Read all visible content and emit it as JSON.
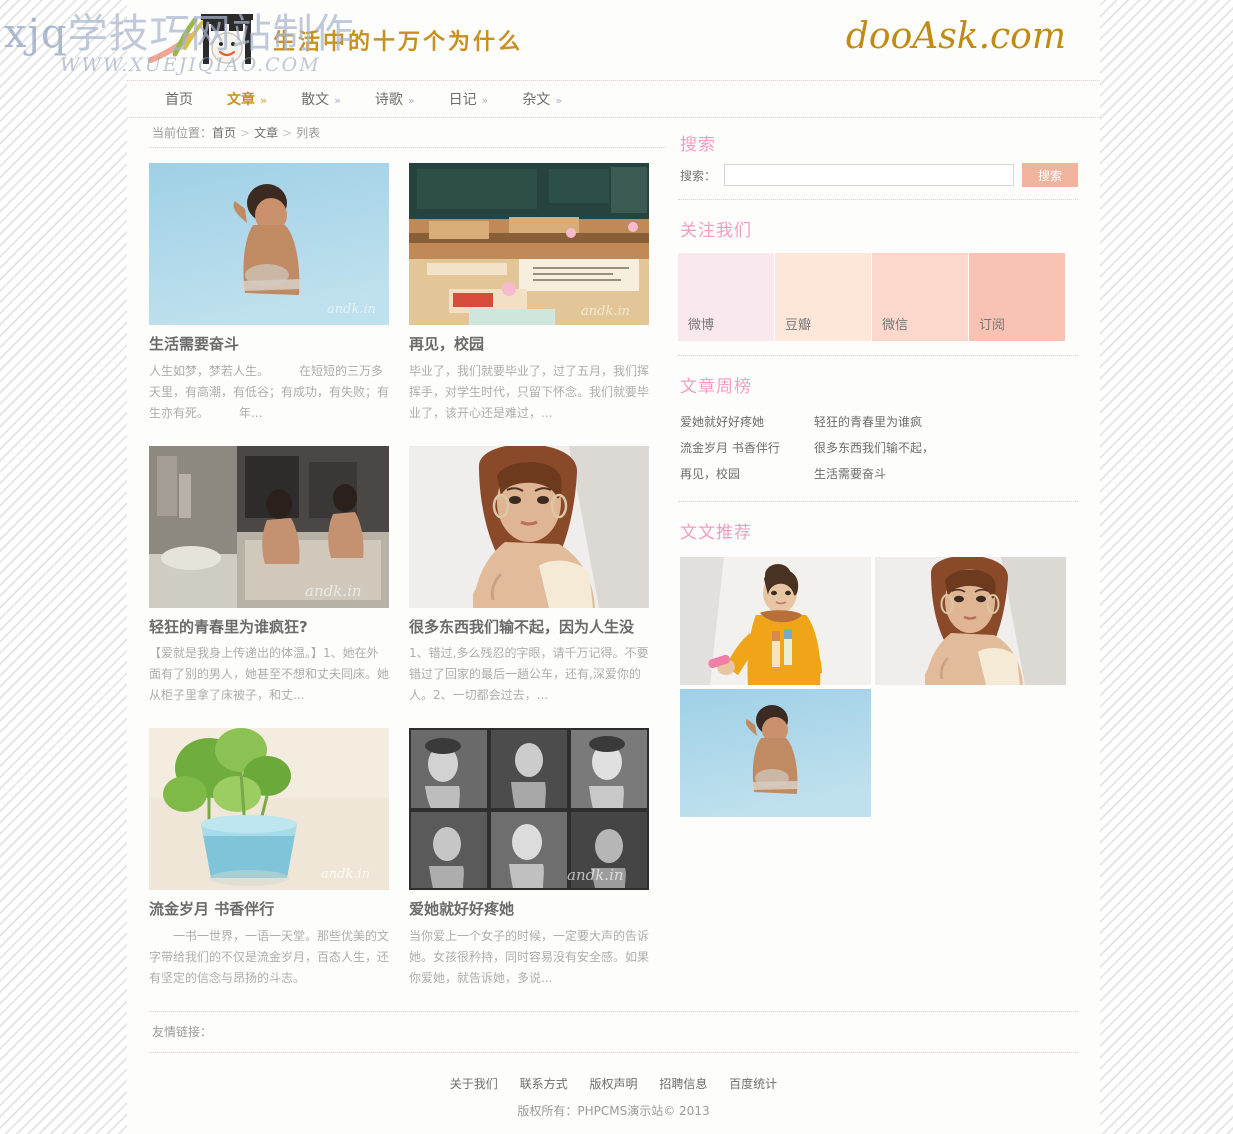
{
  "watermark": {
    "line1_latin": "xjq",
    "line1_cn": "学技巧网站制作",
    "line2": "WWW.XUEJIQIAO.COM"
  },
  "header": {
    "slogan": "生活中的十万个为什么",
    "brand": "dooAsk.com",
    "logo_icon": "gate-face-logo-icon"
  },
  "nav": {
    "items": [
      {
        "label": "首页",
        "arrow": "",
        "active": false
      },
      {
        "label": "文章",
        "arrow": "»",
        "active": true
      },
      {
        "label": "散文",
        "arrow": "»",
        "active": false
      },
      {
        "label": "诗歌",
        "arrow": "»",
        "active": false
      },
      {
        "label": "日记",
        "arrow": "»",
        "active": false
      },
      {
        "label": "杂文",
        "arrow": "»",
        "active": false
      }
    ]
  },
  "breadcrumb": {
    "prefix": "当前位置：",
    "items": [
      "首页",
      "文章",
      "列表"
    ],
    "separator": ">"
  },
  "articles": [
    {
      "title": "生活需要奋斗",
      "desc": "人生如梦，梦若人生。　　　在短短的三万多天里，有高潮，有低谷；有成功，有失败；有生亦有死。　　　年...",
      "thumb": "woman-blue-sky-photo"
    },
    {
      "title": "再见，校园",
      "desc": "毕业了，我们就要毕业了，过了五月，我们挥挥手，对学生时代，只留下怀念。我们就要毕业了，该开心还是难过，...",
      "thumb": "empty-classroom-photo"
    },
    {
      "title": "轻狂的青春里为谁疯狂?",
      "desc": "【爱就是我身上传递出的体温。】1、她在外面有了别的男人，她甚至不想和丈夫同床。她从柜子里拿了床被子，和丈...",
      "thumb": "bathroom-scene-photo"
    },
    {
      "title": "很多东西我们输不起，因为人生没",
      "desc": "1、错过,多么残忍的字眼，请千万记得。不要错过了回家的最后一趟公车，还有,深爱你的人。2、一切都会过去，...",
      "thumb": "portrait-woman-photo"
    },
    {
      "title": "流金岁月 书香伴行",
      "desc": "　　一书一世界，一语一天堂。那些优美的文字带给我们的不仅是流金岁月，百态人生，还有坚定的信念与昂扬的斗志。",
      "thumb": "green-plant-cup-photo"
    },
    {
      "title": "爱她就好好疼她",
      "desc": "当你爱上一个女子的时候，一定要大声的告诉她。女孩很矜持，同时容易没有安全感。如果你爱她，就告诉她，多说...",
      "thumb": "friends-bw-collage-photo"
    }
  ],
  "sidebar": {
    "search": {
      "heading": "搜索",
      "label": "搜索：",
      "value": "",
      "placeholder": "",
      "button": "搜索"
    },
    "follow": {
      "heading": "关注我们",
      "items": [
        {
          "label": "微博",
          "color": "#fae8ef"
        },
        {
          "label": "豆瓣",
          "color": "#fce7d9"
        },
        {
          "label": "微信",
          "color": "#fbd8cb"
        },
        {
          "label": "订阅",
          "color": "#f9c3b4"
        }
      ]
    },
    "rank": {
      "heading": "文章周榜",
      "items": [
        "爱她就好好疼她",
        "轻狂的青春里为谁疯",
        "流金岁月 书香伴行",
        "很多东西我们输不起，",
        "再见，校园",
        "生活需要奋斗"
      ]
    },
    "recommend": {
      "heading": "文文推荐",
      "items": [
        {
          "thumb": "yellow-hoodie-girl-photo"
        },
        {
          "thumb": "portrait-woman-photo"
        },
        {
          "thumb": "woman-blue-sky-photo"
        }
      ]
    }
  },
  "friend_links": {
    "label": "友情链接："
  },
  "footer": {
    "links": [
      "关于我们",
      "联系方式",
      "版权声明",
      "招聘信息",
      "百度统计"
    ],
    "copyright": "版权所有：PHPCMS演示站© 2013"
  },
  "colors": {
    "accent_pink": "#f49cc0",
    "accent_gold": "#c8911f",
    "brand_gold": "#c08a13",
    "button_peach": "#f0b49e",
    "dotted_border": "#f0c8d4"
  }
}
